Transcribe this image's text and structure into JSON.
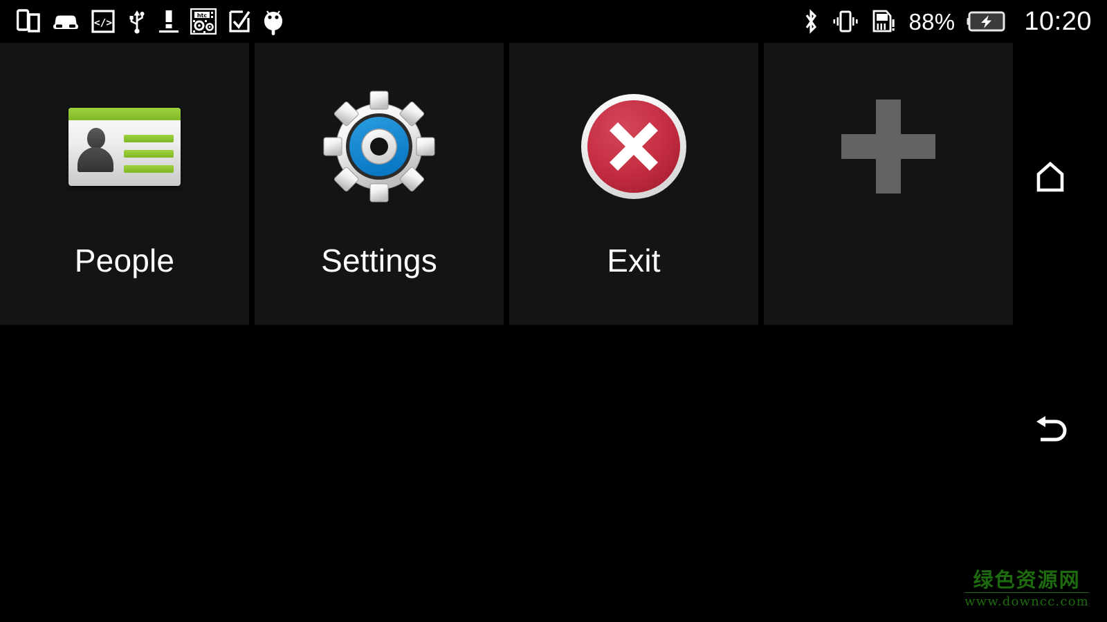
{
  "status_bar": {
    "left_icons": [
      {
        "name": "screen-mirror-icon",
        "label": "Screen mirroring"
      },
      {
        "name": "car-mode-icon",
        "label": "Car mode"
      },
      {
        "name": "developer-code-icon",
        "label": "Developer options"
      },
      {
        "name": "usb-icon",
        "label": "USB connected"
      },
      {
        "name": "warning-exclamation-icon",
        "label": "Warning"
      },
      {
        "name": "htc-qr-icon",
        "label": "HTC service"
      },
      {
        "name": "checkbox-icon",
        "label": "Task complete"
      },
      {
        "name": "android-robot-icon",
        "label": "Android system"
      }
    ],
    "bluetooth_icon": "bluetooth-icon",
    "vibrate_icon": "vibrate-icon",
    "sim_icon": "sim-card-alert-icon",
    "battery_percent": "88%",
    "battery_icon": "battery-charging-icon",
    "clock": "10:20"
  },
  "tiles": [
    {
      "id": "people",
      "label": "People",
      "icon": "contact-card-icon",
      "accent_color": "#8DC63F"
    },
    {
      "id": "settings",
      "label": "Settings",
      "icon": "gear-icon",
      "accent_color": "#1289D4"
    },
    {
      "id": "exit",
      "label": "Exit",
      "icon": "red-x-circle-icon",
      "accent_color": "#C8283C"
    },
    {
      "id": "add",
      "label": "",
      "icon": "plus-icon",
      "accent_color": "#636363"
    }
  ],
  "nav_bar": {
    "home_icon": "home-icon",
    "back_icon": "back-arrow-icon"
  },
  "watermark": {
    "title": "绿色资源网",
    "url": "www.downcc.com",
    "color": "#1E6B0F"
  },
  "theme": {
    "background": "#000000",
    "tile_background": "#141414",
    "text_color": "#FFFFFF"
  }
}
